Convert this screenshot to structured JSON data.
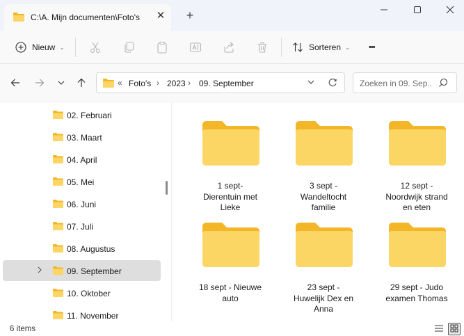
{
  "window": {
    "tab_title": "C:\\A. Mijn documenten\\Foto's",
    "tab_close": "✕",
    "new_tab": "+",
    "minimize": "—",
    "close": "✕"
  },
  "toolbar": {
    "new_label": "Nieuw",
    "sort_label": "Sorteren",
    "more_label": "•••"
  },
  "address": {
    "overflow": "«",
    "crumbs": [
      "Foto's",
      "2023",
      "09. September"
    ],
    "separator": "›"
  },
  "search": {
    "placeholder": "Zoeken in 09. Sep..."
  },
  "sidebar": {
    "items": [
      {
        "label": "02. Februari"
      },
      {
        "label": "03. Maart"
      },
      {
        "label": "04. April"
      },
      {
        "label": "05. Mei"
      },
      {
        "label": "06. Juni"
      },
      {
        "label": "07. Juli"
      },
      {
        "label": "08. Augustus"
      },
      {
        "label": "09. September",
        "selected": true
      },
      {
        "label": "10. Oktober"
      },
      {
        "label": "11. November"
      }
    ]
  },
  "folders": [
    {
      "label": "1 sept-\nDierentuin met\nLieke"
    },
    {
      "label": "3 sept -\nWandeltocht\nfamilie"
    },
    {
      "label": "12 sept -\nNoordwijk strand\nen eten"
    },
    {
      "label": "18 sept - Nieuwe\nauto"
    },
    {
      "label": "23 sept -\nHuwelijk Dex en\nAnna"
    },
    {
      "label": "29 sept - Judo\nexamen Thomas"
    }
  ],
  "status": {
    "item_count": "6 items"
  },
  "colors": {
    "folder_front": "#fcd664",
    "folder_back": "#f3b628",
    "selection": "#dedede",
    "chrome": "#f0f3f9"
  }
}
